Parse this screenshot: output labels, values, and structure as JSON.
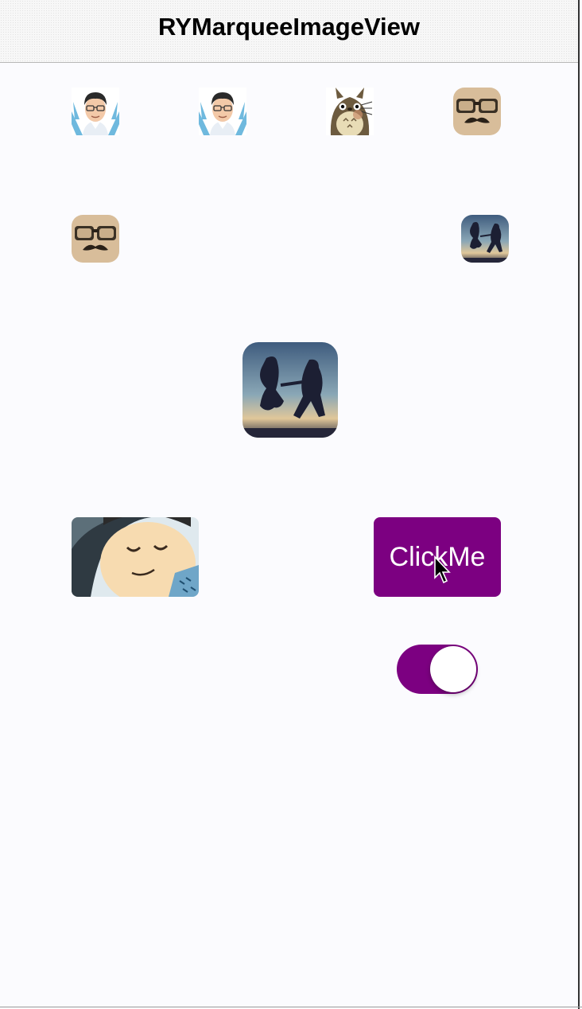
{
  "navbar": {
    "title": "RYMarqueeImageView"
  },
  "button": {
    "label": "ClickMe"
  },
  "toggle": {
    "state": "on"
  },
  "colors": {
    "accent": "#7c0081",
    "nav_bg": "#f7f7f7",
    "page_bg": "#fbfbfe"
  },
  "icons": [
    "man-avatar-icon",
    "man-avatar-icon",
    "totoro-avatar-icon",
    "glasses-mustache-avatar-icon",
    "glasses-mustache-avatar-icon",
    "jumping-couple-photo",
    "jumping-couple-photo",
    "smiling-boy-photo",
    "cursor-arrow-icon"
  ]
}
